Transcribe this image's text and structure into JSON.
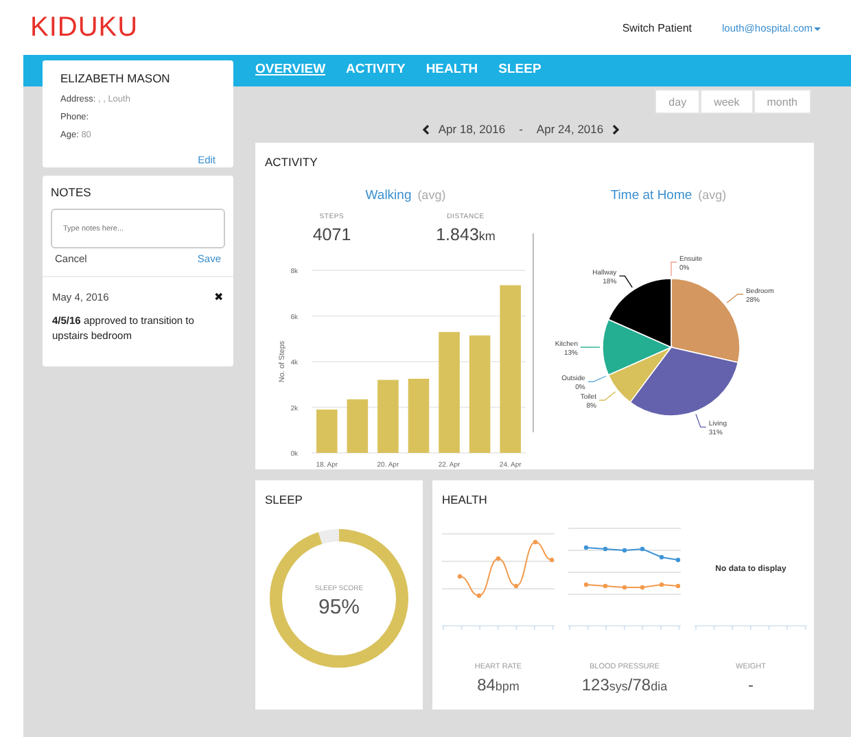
{
  "header": {
    "logo": "KIDUKU",
    "switch_patient": "Switch Patient",
    "user_email": "louth@hospital.com"
  },
  "nav": {
    "tabs": [
      {
        "label": "OVERVIEW",
        "selected": true
      },
      {
        "label": "ACTIVITY",
        "selected": false
      },
      {
        "label": "HEALTH",
        "selected": false
      },
      {
        "label": "SLEEP",
        "selected": false
      }
    ]
  },
  "patient": {
    "name": "ELIZABETH MASON",
    "fields": [
      {
        "label": "Address:",
        "value": ", , Louth"
      },
      {
        "label": "Phone:"
      },
      {
        "label": "Age:",
        "value": "80"
      }
    ],
    "edit": "Edit"
  },
  "notes": {
    "title": "NOTES",
    "placeholder": "Type notes here...",
    "cancel": "Cancel",
    "save": "Save",
    "entries": [
      {
        "date": "May 4, 2016",
        "delete": "✖",
        "text": "**4/5/16** approved to transition to upstairs bedroom"
      }
    ]
  },
  "range": {
    "options": [
      "day",
      "week",
      "month"
    ],
    "start": "Apr 18, 2016",
    "separator": "-",
    "end": "Apr 24, 2016"
  },
  "activity": {
    "title": "ACTIVITY",
    "walking": {
      "title": "Walking",
      "qualifier": "(avg)",
      "stats": [
        {
          "label": "STEPS",
          "value": "4071"
        },
        {
          "label": "DISTANCE",
          "value": "1.843",
          "unit": "km"
        }
      ],
      "chart_data": {
        "type": "bar",
        "ylabel": "No. of Steps",
        "categories": [
          "18. Apr",
          null,
          "20. Apr",
          null,
          "22. Apr",
          null,
          "24. Apr"
        ],
        "grid": true,
        "series": [
          {
            "color": "#d9c25c",
            "values": [
              1900,
              2350,
              3200,
              3250,
              5300,
              5150,
              7350
            ]
          }
        ],
        "ylim": [
          0,
          8000
        ],
        "yticks": [
          {
            "value": 0,
            "label": "0k"
          },
          {
            "value": 2000,
            "label": "2k"
          },
          {
            "value": 4000,
            "label": "4k"
          },
          {
            "value": 6000,
            "label": "6k"
          },
          {
            "value": 8000,
            "label": "8k"
          }
        ]
      }
    },
    "time_at_home": {
      "title": "Time at Home",
      "qualifier": "(avg)",
      "chart_data": {
        "type": "pie",
        "categories": [
          "Ensuite",
          "Bedroom",
          "Living",
          "Toilet",
          "Outside",
          "Kitchen",
          "Hallway"
        ],
        "values": [
          0,
          28,
          31,
          8,
          0,
          13,
          18
        ],
        "value_labels": [
          "0%",
          "28%",
          "31%",
          "8%",
          "0%",
          "13%",
          "18%"
        ],
        "colors": [
          "#ef9f8c",
          "#d4975f",
          "#6462ad",
          "#d8c05a",
          "#6ab0d8",
          "#24ae92",
          "#000000"
        ]
      }
    }
  },
  "sleep": {
    "title": "SLEEP",
    "label": "SLEEP SCORE",
    "value": "95%",
    "level": 0.95
  },
  "health": {
    "title": "HEALTH",
    "metrics": [
      {
        "kind": "heart_rate",
        "label": "HEART RATE",
        "parts": [
          {
            "text": "84",
            "kind": "number"
          },
          {
            "text": "bpm",
            "kind": "unit"
          }
        ]
      },
      {
        "kind": "blood_pressure",
        "label": "BLOOD PRESSURE",
        "parts": [
          {
            "text": "123",
            "kind": "number"
          },
          {
            "text": "sys",
            "kind": "unit"
          },
          {
            "text": "/78",
            "kind": "number"
          },
          {
            "text": "dia",
            "kind": "unit"
          }
        ]
      },
      {
        "kind": "weight",
        "label": "WEIGHT",
        "empty_message": "No data to display",
        "parts": [
          {
            "text": "-",
            "kind": "number"
          }
        ]
      }
    ]
  }
}
